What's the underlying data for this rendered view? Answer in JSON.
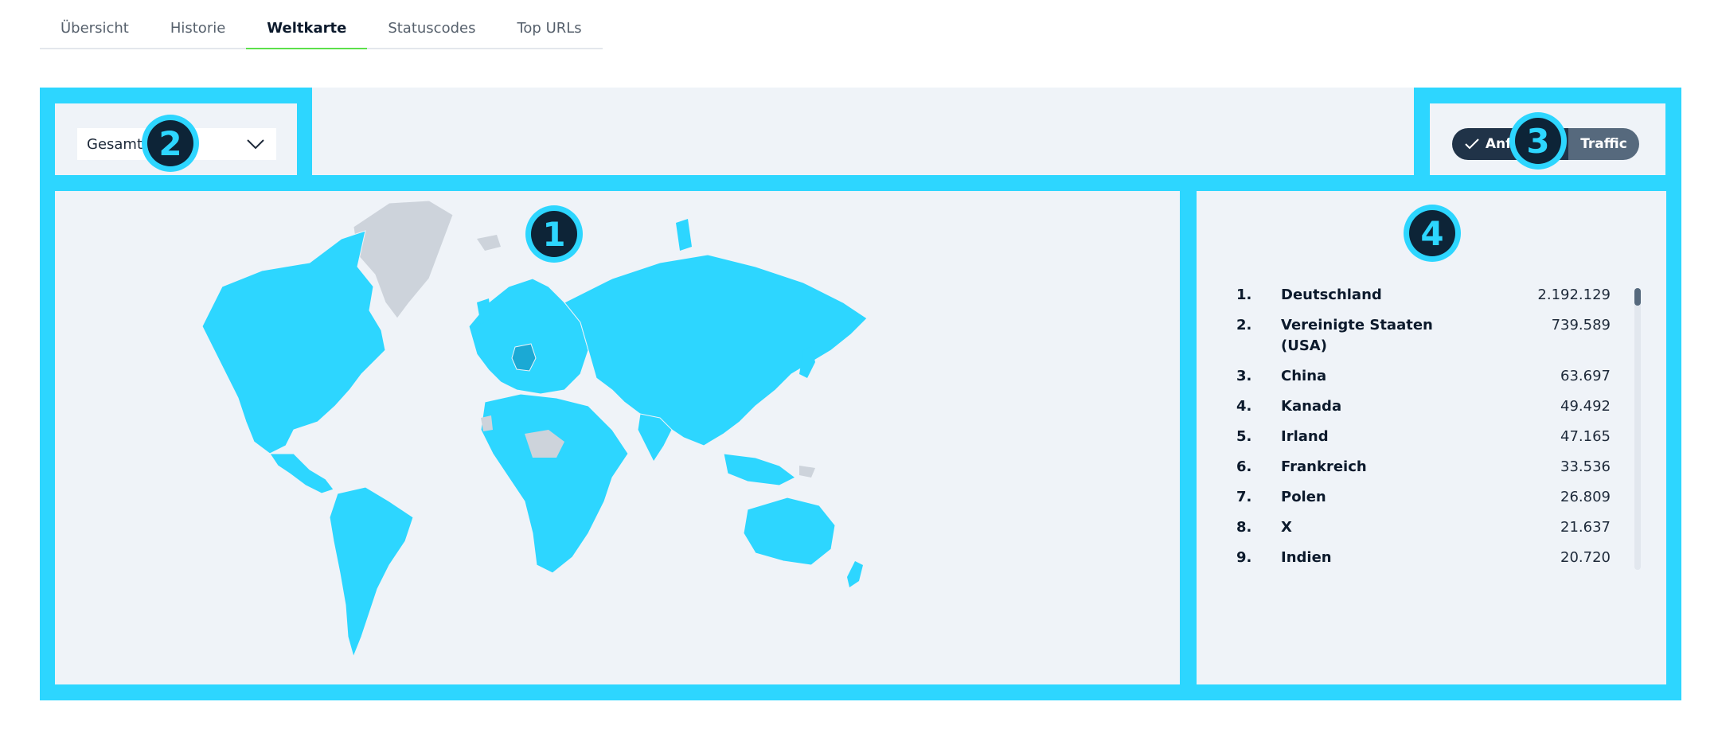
{
  "tabs": [
    {
      "label": "Übersicht",
      "active": false
    },
    {
      "label": "Historie",
      "active": false
    },
    {
      "label": "Weltkarte",
      "active": true
    },
    {
      "label": "Statuscodes",
      "active": false
    },
    {
      "label": "Top URLs",
      "active": false
    }
  ],
  "filter": {
    "selected": "Gesamt"
  },
  "toggle": {
    "left_label": "Anfragen",
    "right_label": "Traffic",
    "active": "left"
  },
  "badges": {
    "map": "1",
    "filter": "2",
    "toggle": "3",
    "ranking": "4"
  },
  "ranking": [
    {
      "rank": "1.",
      "country": "Deutschland",
      "value": "2.192.129"
    },
    {
      "rank": "2.",
      "country": "Vereinigte Staaten (USA)",
      "value": "739.589"
    },
    {
      "rank": "3.",
      "country": "China",
      "value": "63.697"
    },
    {
      "rank": "4.",
      "country": "Kanada",
      "value": "49.492"
    },
    {
      "rank": "5.",
      "country": "Irland",
      "value": "47.165"
    },
    {
      "rank": "6.",
      "country": "Frankreich",
      "value": "33.536"
    },
    {
      "rank": "7.",
      "country": "Polen",
      "value": "26.809"
    },
    {
      "rank": "8.",
      "country": "X",
      "value": "21.637"
    },
    {
      "rank": "9.",
      "country": "Indien",
      "value": "20.720"
    }
  ],
  "colors": {
    "highlight": "#2dd6ff",
    "map_fill": "#2dd6ff",
    "map_top_country": "#1ba9d4",
    "map_no_data": "#cdd3db",
    "active_tab_underline": "#5ce04b",
    "toggle_active": "#203348",
    "toggle_inactive": "#56697d"
  }
}
